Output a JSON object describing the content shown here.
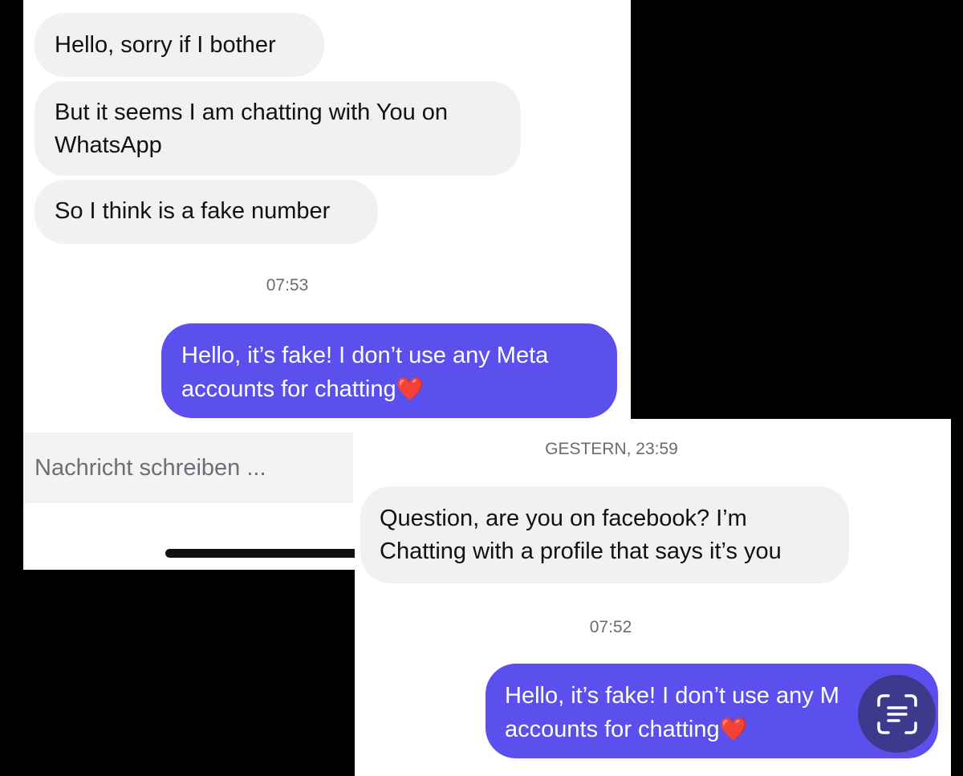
{
  "screenshot_top": {
    "messages": [
      {
        "direction": "incoming",
        "lines": [
          "Hello, sorry if I bother"
        ]
      },
      {
        "direction": "incoming",
        "lines": [
          "But it seems I am chatting with You on",
          "WhatsApp"
        ]
      },
      {
        "direction": "incoming",
        "lines": [
          "So I think is a fake number"
        ]
      }
    ],
    "timestamp": "07:53",
    "reply": {
      "line1": "Hello, it’s fake! I don’t use any Meta",
      "line2": "accounts for chatting",
      "emoji": "❤️"
    },
    "composer": {
      "placeholder": "Nachricht schreiben ..."
    }
  },
  "screenshot_bottom": {
    "date_header": "GESTERN, 23:59",
    "message": {
      "line1": "Question, are you on facebook? I’m",
      "line2": "Chatting with a profile that says it’s you"
    },
    "timestamp": "07:52",
    "reply": {
      "line1": "Hello, it’s fake! I don’t use any M",
      "line2": "accounts for chatting",
      "emoji": "❤️"
    },
    "fab_icon": "text-scan-icon"
  },
  "colors": {
    "incoming_bubble": "#f1f1f3",
    "outgoing_bubble": "#5b4fee",
    "background": "#000000"
  }
}
